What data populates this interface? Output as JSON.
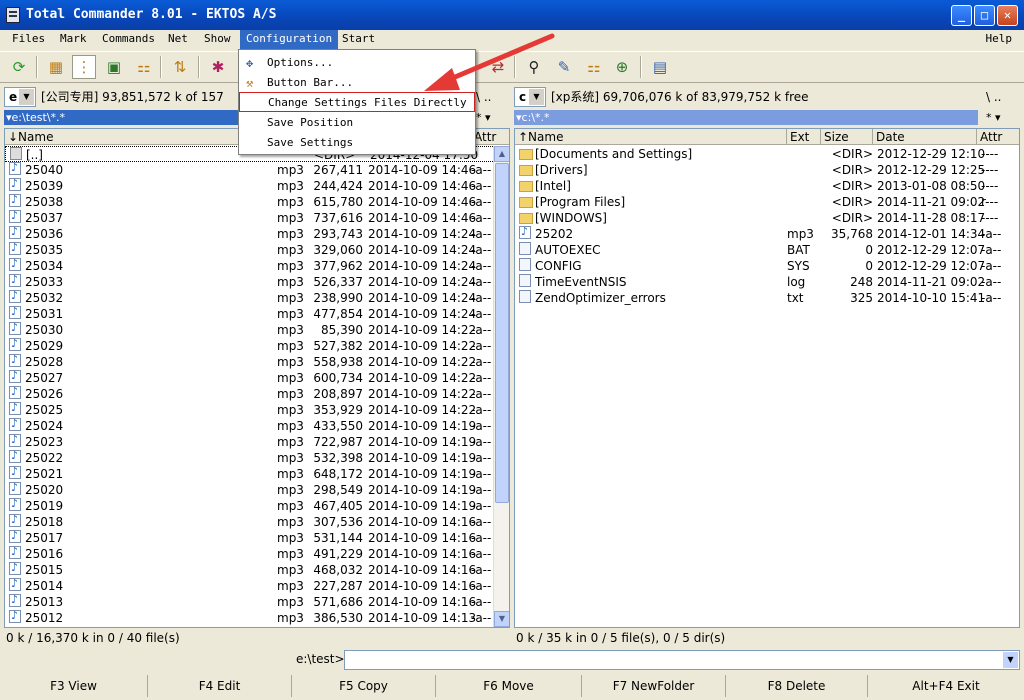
{
  "window": {
    "title": "Total Commander 8.01 - EKTOS A/S",
    "controls": [
      "_",
      "□",
      "✕"
    ]
  },
  "menu": {
    "items": [
      "Files",
      "Mark",
      "Commands",
      "Net",
      "Show",
      "Configuration",
      "Start"
    ],
    "help": "Help"
  },
  "config_menu": {
    "items": [
      "Options...",
      "Button Bar...",
      "Change Settings Files Directly",
      "Save Position",
      "Save Settings"
    ]
  },
  "left": {
    "drive": "e",
    "drive_info": "[公司专用]  93,851,572 k of  157",
    "path": "▾e:\\test\\*.*",
    "path_ctrl": "* ▾",
    "nav": "\\  ..",
    "headers": {
      "name": "↓Name",
      "ext": "Ext",
      "attr": "Attr"
    },
    "up_row": {
      "name": "[..]",
      "size": "<DIR>",
      "date": "2014-12-04 17:50"
    },
    "files": [
      {
        "name": "25040",
        "ext": "mp3",
        "size": "267,411",
        "date": "2014-10-09 14:46",
        "attr": "-a--"
      },
      {
        "name": "25039",
        "ext": "mp3",
        "size": "244,424",
        "date": "2014-10-09 14:46",
        "attr": "-a--"
      },
      {
        "name": "25038",
        "ext": "mp3",
        "size": "615,780",
        "date": "2014-10-09 14:46",
        "attr": "-a--"
      },
      {
        "name": "25037",
        "ext": "mp3",
        "size": "737,616",
        "date": "2014-10-09 14:46",
        "attr": "-a--"
      },
      {
        "name": "25036",
        "ext": "mp3",
        "size": "293,743",
        "date": "2014-10-09 14:24",
        "attr": "-a--"
      },
      {
        "name": "25035",
        "ext": "mp3",
        "size": "329,060",
        "date": "2014-10-09 14:24",
        "attr": "-a--"
      },
      {
        "name": "25034",
        "ext": "mp3",
        "size": "377,962",
        "date": "2014-10-09 14:24",
        "attr": "-a--"
      },
      {
        "name": "25033",
        "ext": "mp3",
        "size": "526,337",
        "date": "2014-10-09 14:24",
        "attr": "-a--"
      },
      {
        "name": "25032",
        "ext": "mp3",
        "size": "238,990",
        "date": "2014-10-09 14:24",
        "attr": "-a--"
      },
      {
        "name": "25031",
        "ext": "mp3",
        "size": "477,854",
        "date": "2014-10-09 14:24",
        "attr": "-a--"
      },
      {
        "name": "25030",
        "ext": "mp3",
        "size": "85,390",
        "date": "2014-10-09 14:22",
        "attr": "-a--"
      },
      {
        "name": "25029",
        "ext": "mp3",
        "size": "527,382",
        "date": "2014-10-09 14:22",
        "attr": "-a--"
      },
      {
        "name": "25028",
        "ext": "mp3",
        "size": "558,938",
        "date": "2014-10-09 14:22",
        "attr": "-a--"
      },
      {
        "name": "25027",
        "ext": "mp3",
        "size": "600,734",
        "date": "2014-10-09 14:22",
        "attr": "-a--"
      },
      {
        "name": "25026",
        "ext": "mp3",
        "size": "208,897",
        "date": "2014-10-09 14:22",
        "attr": "-a--"
      },
      {
        "name": "25025",
        "ext": "mp3",
        "size": "353,929",
        "date": "2014-10-09 14:22",
        "attr": "-a--"
      },
      {
        "name": "25024",
        "ext": "mp3",
        "size": "433,550",
        "date": "2014-10-09 14:19",
        "attr": "-a--"
      },
      {
        "name": "25023",
        "ext": "mp3",
        "size": "722,987",
        "date": "2014-10-09 14:19",
        "attr": "-a--"
      },
      {
        "name": "25022",
        "ext": "mp3",
        "size": "532,398",
        "date": "2014-10-09 14:19",
        "attr": "-a--"
      },
      {
        "name": "25021",
        "ext": "mp3",
        "size": "648,172",
        "date": "2014-10-09 14:19",
        "attr": "-a--"
      },
      {
        "name": "25020",
        "ext": "mp3",
        "size": "298,549",
        "date": "2014-10-09 14:19",
        "attr": "-a--"
      },
      {
        "name": "25019",
        "ext": "mp3",
        "size": "467,405",
        "date": "2014-10-09 14:19",
        "attr": "-a--"
      },
      {
        "name": "25018",
        "ext": "mp3",
        "size": "307,536",
        "date": "2014-10-09 14:16",
        "attr": "-a--"
      },
      {
        "name": "25017",
        "ext": "mp3",
        "size": "531,144",
        "date": "2014-10-09 14:16",
        "attr": "-a--"
      },
      {
        "name": "25016",
        "ext": "mp3",
        "size": "491,229",
        "date": "2014-10-09 14:16",
        "attr": "-a--"
      },
      {
        "name": "25015",
        "ext": "mp3",
        "size": "468,032",
        "date": "2014-10-09 14:16",
        "attr": "-a--"
      },
      {
        "name": "25014",
        "ext": "mp3",
        "size": "227,287",
        "date": "2014-10-09 14:16",
        "attr": "-a--"
      },
      {
        "name": "25013",
        "ext": "mp3",
        "size": "571,686",
        "date": "2014-10-09 14:16",
        "attr": "-a--"
      },
      {
        "name": "25012",
        "ext": "mp3",
        "size": "386,530",
        "date": "2014-10-09 14:13",
        "attr": "-a--"
      }
    ],
    "status": "0 k / 16,370 k in 0 / 40 file(s)"
  },
  "right": {
    "drive": "c",
    "drive_info": "[xp系统]  69,706,076 k of  83,979,752 k free",
    "path": "▾c:\\*.*",
    "path_ctrl": "* ▾",
    "nav": "\\  ..",
    "headers": {
      "name": "↑Name",
      "ext": "Ext",
      "size": "Size",
      "date": "Date",
      "attr": "Attr"
    },
    "files": [
      {
        "name": "[Documents and Settings]",
        "ext": "",
        "size": "<DIR>",
        "date": "2012-12-29 12:10",
        "attr": "----",
        "type": "folder"
      },
      {
        "name": "[Drivers]",
        "ext": "",
        "size": "<DIR>",
        "date": "2012-12-29 12:25",
        "attr": "----",
        "type": "folder"
      },
      {
        "name": "[Intel]",
        "ext": "",
        "size": "<DIR>",
        "date": "2013-01-08 08:50",
        "attr": "----",
        "type": "folder"
      },
      {
        "name": "[Program Files]",
        "ext": "",
        "size": "<DIR>",
        "date": "2014-11-21 09:02",
        "attr": "r---",
        "type": "folder"
      },
      {
        "name": "[WINDOWS]",
        "ext": "",
        "size": "<DIR>",
        "date": "2014-11-28 08:17",
        "attr": "----",
        "type": "folder"
      },
      {
        "name": "25202",
        "ext": "mp3",
        "size": "35,768",
        "date": "2014-12-01 14:34",
        "attr": "-a--",
        "type": "mp3"
      },
      {
        "name": "AUTOEXEC",
        "ext": "BAT",
        "size": "0",
        "date": "2012-12-29 12:07",
        "attr": "-a--",
        "type": "doc"
      },
      {
        "name": "CONFIG",
        "ext": "SYS",
        "size": "0",
        "date": "2012-12-29 12:07",
        "attr": "-a--",
        "type": "doc"
      },
      {
        "name": "TimeEventNSIS",
        "ext": "log",
        "size": "248",
        "date": "2014-11-21 09:02",
        "attr": "-a--",
        "type": "doc"
      },
      {
        "name": "ZendOptimizer_errors",
        "ext": "txt",
        "size": "325",
        "date": "2014-10-10 15:41",
        "attr": "-a--",
        "type": "doc"
      }
    ],
    "status": "0 k / 35 k in 0 / 5 file(s), 0 / 5 dir(s)"
  },
  "cmdline": {
    "label": "e:\\test>"
  },
  "fkeys": [
    "F3 View",
    "F4 Edit",
    "F5 Copy",
    "F6 Move",
    "F7 NewFolder",
    "F8 Delete",
    "Alt+F4 Exit"
  ],
  "toolbar_icons": [
    "refresh-icon",
    "brief-view-icon",
    "full-view-icon",
    "thumbnail-view-icon",
    "tree-view-icon",
    "compare-icon",
    "pack-icon",
    "unpack-icon",
    "search-icon",
    "rename-icon",
    "sync-icon",
    "ftp-icon",
    "notepad-icon"
  ],
  "colors": {
    "title": "#0a5bd6",
    "selection": "#316ac5",
    "annotation": "#e53935"
  }
}
